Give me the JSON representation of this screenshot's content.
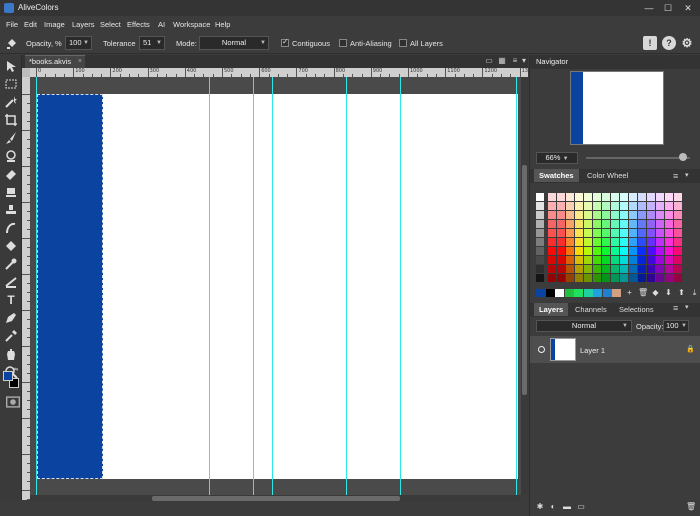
{
  "app": {
    "title": "AliveColors"
  },
  "window_controls": {
    "minimize": "—",
    "maximize": "☐",
    "close": "✕"
  },
  "menu": [
    "File",
    "Edit",
    "Image",
    "Layers",
    "Select",
    "Effects",
    "AI",
    "Workspace",
    "Help"
  ],
  "options": {
    "opacity_label": "Opacity, %",
    "opacity_value": "100",
    "tolerance_label": "Tolerance",
    "tolerance_value": "51",
    "mode_label": "Mode:",
    "mode_value": "Normal",
    "contiguous_label": "Contiguous",
    "contiguous_checked": true,
    "antialiasing_label": "Anti-Aliasing",
    "antialiasing_checked": false,
    "all_layers_label": "All Layers",
    "all_layers_checked": false
  },
  "right_icons": [
    "feedback-icon",
    "help-icon",
    "settings-icon"
  ],
  "document": {
    "tab_label": "*books.akvis",
    "tab_close": "×"
  },
  "ruler": {
    "h_labels": [
      "0",
      "100",
      "200",
      "300",
      "400",
      "500",
      "600",
      "700",
      "800",
      "900",
      "1000",
      "1100",
      "1200",
      "1300",
      "1400"
    ]
  },
  "colors": {
    "foreground": "#0a44a0",
    "background": "#000000",
    "canvas_block": "#0a44a0",
    "guide": "#2ee6e6"
  },
  "navigator": {
    "title": "Navigator",
    "zoom": "66%",
    "zoom_level": 0.93
  },
  "swatches": {
    "tab_active": "Swatches",
    "tab_other": "Color Wheel",
    "recent": [
      "#0a44a0",
      "#000000",
      "#ffffff",
      "#20c040",
      "#20e060",
      "#20d0a0",
      "#20a0e0",
      "#2080d0",
      "#d0a080"
    ]
  },
  "layers": {
    "tabs": [
      "Layers",
      "Channels",
      "Selections"
    ],
    "blend_mode": "Normal",
    "opacity_label": "Opacity:",
    "opacity_value": "100",
    "items": [
      {
        "name": "Layer 1",
        "locked": true
      }
    ]
  }
}
